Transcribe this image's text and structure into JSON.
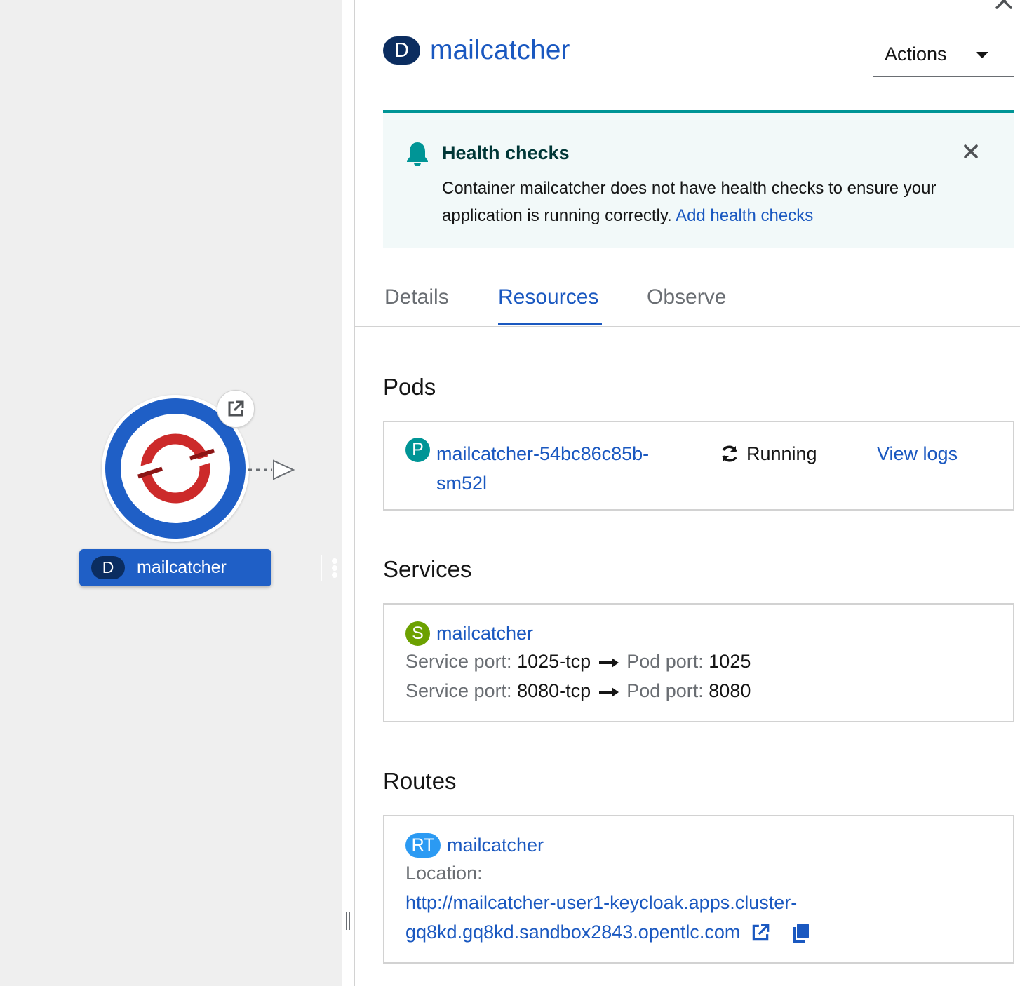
{
  "topology": {
    "node": {
      "kind_badge": "D",
      "name": "mailcatcher"
    }
  },
  "panel": {
    "kind_badge": "D",
    "title": "mailcatcher",
    "actions_label": "Actions",
    "alert": {
      "title": "Health checks",
      "message": "Container mailcatcher does not have health checks to ensure your application is running correctly.",
      "link": "Add health checks"
    },
    "tabs": [
      {
        "label": "Details"
      },
      {
        "label": "Resources"
      },
      {
        "label": "Observe"
      }
    ],
    "active_tab": "Resources",
    "pods": {
      "section_title": "Pods",
      "items": [
        {
          "badge": "P",
          "name_line1": "mailcatcher-54bc86c85b-",
          "name_line2": "sm52l",
          "status": "Running",
          "logs_link": "View logs"
        }
      ]
    },
    "services": {
      "section_title": "Services",
      "items": [
        {
          "badge": "S",
          "name": "mailcatcher",
          "ports": [
            {
              "service_label": "Service port:",
              "service_port": "1025-tcp",
              "pod_label": "Pod port:",
              "pod_port": "1025"
            },
            {
              "service_label": "Service port:",
              "service_port": "8080-tcp",
              "pod_label": "Pod port:",
              "pod_port": "8080"
            }
          ]
        }
      ]
    },
    "routes": {
      "section_title": "Routes",
      "items": [
        {
          "badge": "RT",
          "name": "mailcatcher",
          "location_label": "Location:",
          "url_line1": "http://mailcatcher-user1-keycloak.apps.cluster-",
          "url_line2": "gq8kd.gq8kd.sandbox2843.opentlc.com"
        }
      ]
    }
  },
  "colors": {
    "link_blue": "#1a58c0",
    "node_blue": "#1f5fc6",
    "badge_dark": "#0b2d60",
    "pod_badge": "#009596",
    "service_badge": "#6ca100",
    "route_badge": "#2b9af3",
    "alert_teal": "#009596",
    "openshift_red": "#cc2a2a"
  }
}
